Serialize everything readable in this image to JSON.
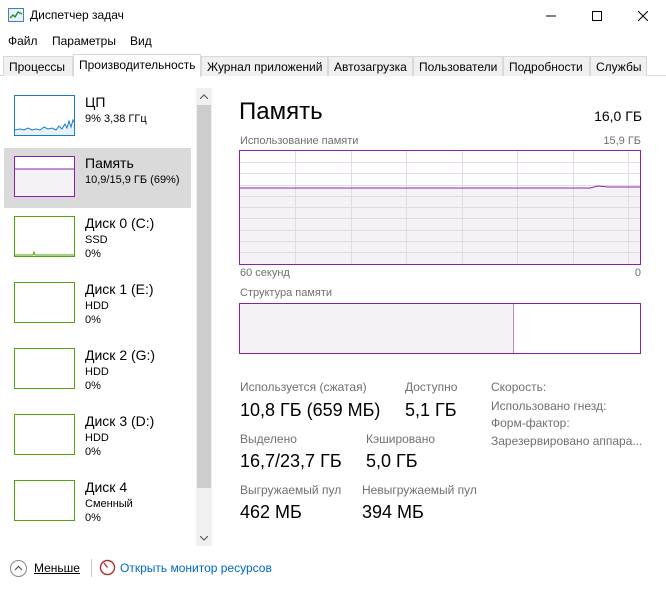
{
  "window": {
    "title": "Диспетчер задач",
    "minimize_glyph": "—",
    "maximize_glyph": "☐",
    "close_glyph": "✕"
  },
  "menu": [
    "Файл",
    "Параметры",
    "Вид"
  ],
  "tabs": [
    {
      "label": "Процессы",
      "active": false
    },
    {
      "label": "Производительность",
      "active": true
    },
    {
      "label": "Журнал приложений",
      "active": false
    },
    {
      "label": "Автозагрузка",
      "active": false
    },
    {
      "label": "Пользователи",
      "active": false
    },
    {
      "label": "Подробности",
      "active": false
    },
    {
      "label": "Службы",
      "active": false
    }
  ],
  "sidebar": {
    "items": [
      {
        "title": "ЦП",
        "line1": "9% 3,38 ГГц",
        "line2": "",
        "color": "#1c7cc0",
        "selected": false
      },
      {
        "title": "Память",
        "line1": "10,9/15,9 ГБ (69%)",
        "line2": "",
        "color": "#8b1fa9",
        "selected": true
      },
      {
        "title": "Диск 0 (C:)",
        "line1": "SSD",
        "line2": "0%",
        "color": "#4da60c",
        "selected": false
      },
      {
        "title": "Диск 1 (E:)",
        "line1": "HDD",
        "line2": "0%",
        "color": "#4da60c",
        "selected": false
      },
      {
        "title": "Диск 2 (G:)",
        "line1": "HDD",
        "line2": "0%",
        "color": "#4da60c",
        "selected": false
      },
      {
        "title": "Диск 3 (D:)",
        "line1": "HDD",
        "line2": "0%",
        "color": "#4da60c",
        "selected": false
      },
      {
        "title": "Диск 4",
        "line1": "Сменный",
        "line2": "0%",
        "color": "#4da60c",
        "selected": false
      }
    ]
  },
  "main": {
    "title": "Память",
    "total": "16,0 ГБ",
    "usage_label": "Использование памяти",
    "usage_max": "15,9 ГБ",
    "axis_left": "60 секунд",
    "axis_right": "0",
    "structure_label": "Структура памяти",
    "usage_fraction": 0.69,
    "accent_color": "#8b1fa9",
    "stats": {
      "in_use_label": "Используется (сжатая)",
      "in_use_value": "10,8 ГБ (659 МБ)",
      "available_label": "Доступно",
      "available_value": "5,1 ГБ",
      "committed_label": "Выделено",
      "committed_value": "16,7/23,7 ГБ",
      "cached_label": "Кэшировано",
      "cached_value": "5,0 ГБ",
      "paged_label": "Выгружаемый пул",
      "paged_value": "462 МБ",
      "nonpaged_label": "Невыгружаемый пул",
      "nonpaged_value": "394 МБ",
      "speed_label": "Скорость:",
      "slots_label": "Использовано гнезд:",
      "form_label": "Форм-фактор:",
      "reserved_label": "Зарезервировано аппара..."
    }
  },
  "footer": {
    "fewer_label": "Меньше",
    "resmon_label": "Открыть монитор ресурсов"
  }
}
